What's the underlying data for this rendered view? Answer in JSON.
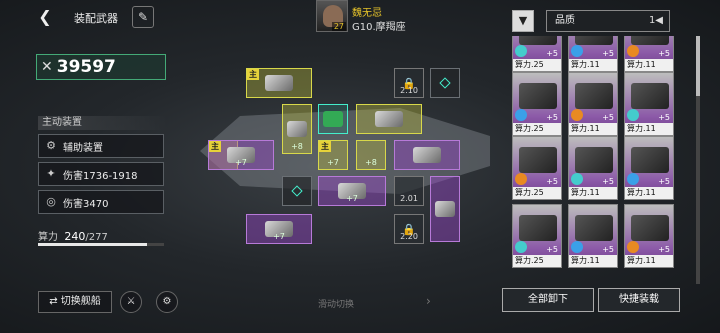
{
  "header": {
    "back": "❮",
    "title": "装配武器",
    "captain_level": "27",
    "captain_name": "魏无忌",
    "fleet": "G10.摩羯座"
  },
  "left": {
    "power": "39597",
    "power_icon": "swords-icon",
    "active_label": "主动装置",
    "stats": [
      {
        "icon": "gear-icon",
        "label": "辅助装置"
      },
      {
        "icon": "damage-icon",
        "label": "伤害1736-1918"
      },
      {
        "icon": "target-icon",
        "label": "伤害3470"
      }
    ],
    "compute_label": "算力",
    "compute_used": "240",
    "compute_total": "/277",
    "compute_fraction": 0.866,
    "switch_label": "⇄ 切换舰船",
    "slide_hint": "滑动切换",
    "slide_arrow": "›"
  },
  "slots": {
    "tag": "主",
    "plus7": "+7",
    "plus8": "+8",
    "lock_1": "2.10",
    "lock_2": "2.01",
    "lock_3": "2.20"
  },
  "right": {
    "quality_label": "品质",
    "sort_icon": "1◀",
    "card_cp": [
      "算力.25",
      "算力.11",
      "算力.11",
      "算力.25",
      "算力.11",
      "算力.11",
      "算力.25",
      "算力.11",
      "算力.11",
      "算力.25",
      "算力.11",
      "算力.11"
    ],
    "plus5": "+5",
    "unload_label": "全部卸下",
    "equip_label": "快捷装载"
  },
  "colors": {
    "yellow_slot": "#d8d84a",
    "purple_slot": "#b77ad8",
    "teal_slot": "#44eecc"
  }
}
